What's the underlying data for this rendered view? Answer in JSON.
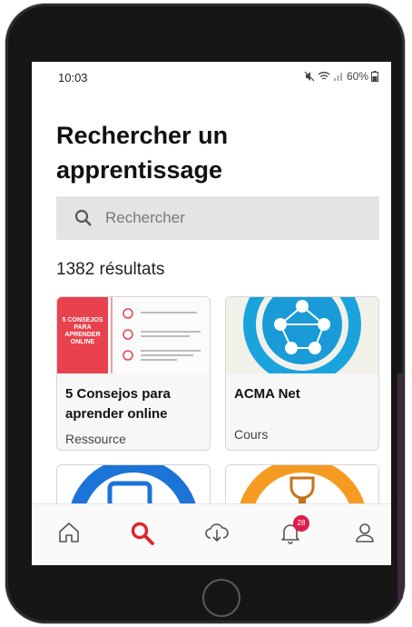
{
  "status": {
    "time": "10:03",
    "battery": "60%"
  },
  "page": {
    "title": "Rechercher un apprentissage"
  },
  "search": {
    "placeholder": "Rechercher"
  },
  "results": {
    "count_label": "1382 résultats"
  },
  "cards": [
    {
      "title": "5 Consejos para aprender online",
      "type": "Ressource",
      "thumb_text": "5 CONSEJOS PARA APRENDER ONLINE"
    },
    {
      "title": "ACMA Net",
      "type": "Cours"
    }
  ],
  "tabbar": {
    "notifications_badge": "28",
    "accent": "#e0252d"
  },
  "icons": [
    "home-icon",
    "search-icon",
    "download-cloud-icon",
    "bell-icon",
    "profile-icon",
    "wifi-icon",
    "signal-icon",
    "battery-icon",
    "mute-icon"
  ]
}
